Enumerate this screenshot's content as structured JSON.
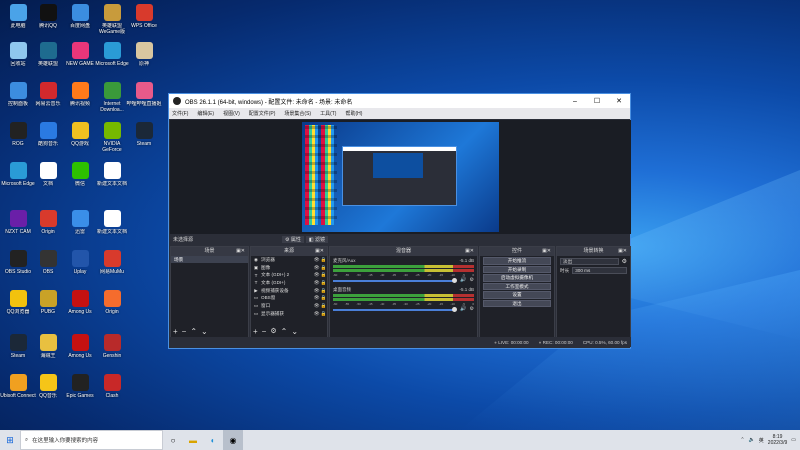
{
  "desktop_icons": [
    {
      "label": "此电脑",
      "color": "#4aa3e8",
      "icon": "computer-icon"
    },
    {
      "label": "腾讯QQ",
      "color": "#111111",
      "icon": "qq-icon"
    },
    {
      "label": "百度网盘",
      "color": "#3b8de0",
      "icon": "baidu-netdisk-icon"
    },
    {
      "label": "英雄联盟WeGame版",
      "color": "#c89b3c",
      "icon": "lol-icon"
    },
    {
      "label": "WPS Office",
      "color": "#d83a2c",
      "icon": "wps-icon"
    },
    {
      "label": "回收站",
      "color": "#8fc7ee",
      "icon": "recycle-bin-icon"
    },
    {
      "label": "英雄联盟",
      "color": "#1e6b8f",
      "icon": "league-icon"
    },
    {
      "label": "NEW GAME",
      "color": "#e8367a",
      "icon": "new-game-icon"
    },
    {
      "label": "Microsoft Edge",
      "color": "#2a9bd6",
      "icon": "edge-icon"
    },
    {
      "label": "原神",
      "color": "#d8c6a0",
      "icon": "genshin-icon"
    },
    {
      "label": "控制面板",
      "color": "#3c8de0",
      "icon": "control-panel-icon"
    },
    {
      "label": "网易云音乐",
      "color": "#d2292d",
      "icon": "netease-music-icon"
    },
    {
      "label": "腾讯视频",
      "color": "#ff7a1a",
      "icon": "tencent-video-icon"
    },
    {
      "label": "Internet Downloa...",
      "color": "#3a9a3a",
      "icon": "idm-icon"
    },
    {
      "label": "哔哩哔哩直播姬",
      "color": "#e85a8a",
      "icon": "bilibili-live-icon"
    },
    {
      "label": "ROG",
      "color": "#222222",
      "icon": "rog-icon"
    },
    {
      "label": "酷狗音乐",
      "color": "#2a7ae2",
      "icon": "kugou-icon"
    },
    {
      "label": "QQ游戏",
      "color": "#f0c020",
      "icon": "qq-game-icon"
    },
    {
      "label": "NVIDIA GeForce",
      "color": "#76b900",
      "icon": "nvidia-icon"
    },
    {
      "label": "Steam",
      "color": "#1b2838",
      "icon": "steam-icon"
    },
    {
      "label": "Microsoft Edge",
      "color": "#2a9bd6",
      "icon": "edge-icon"
    },
    {
      "label": "文档",
      "color": "#ffffff",
      "icon": "document-icon"
    },
    {
      "label": "微信",
      "color": "#2dc100",
      "icon": "wechat-icon"
    },
    {
      "label": "新建文本文档",
      "color": "#ffffff",
      "icon": "text-file-icon"
    },
    {
      "label": "NZXT CAM",
      "color": "#6a1fa8",
      "icon": "nzxt-icon"
    },
    {
      "label": "Origin",
      "color": "#d83a2c",
      "icon": "origin-icon"
    },
    {
      "label": "迅雷",
      "color": "#3a8ee8",
      "icon": "xunlei-icon"
    },
    {
      "label": "新建文本文档",
      "color": "#ffffff",
      "icon": "text-file-icon"
    },
    {
      "label": "OBS Studio",
      "color": "#222222",
      "icon": "obs-icon"
    },
    {
      "label": "OBS",
      "color": "#333333",
      "icon": "obs-icon"
    },
    {
      "label": "Uplay",
      "color": "#2255aa",
      "icon": "uplay-icon"
    },
    {
      "label": "网易MuMu",
      "color": "#d83a2c",
      "icon": "mumu-icon"
    },
    {
      "label": "QQ浏览器",
      "color": "#f2c20e",
      "icon": "qq-browser-icon"
    },
    {
      "label": "PUBG",
      "color": "#c9a227",
      "icon": "pubg-icon"
    },
    {
      "label": "Among Us",
      "color": "#c51111",
      "icon": "among-us-icon"
    },
    {
      "label": "Origin",
      "color": "#f56c2d",
      "icon": "origin-icon"
    },
    {
      "label": "Steam",
      "color": "#1b2838",
      "icon": "steam-icon"
    },
    {
      "label": "海贼王",
      "color": "#e8c040",
      "icon": "onepiece-icon"
    },
    {
      "label": "Among Us",
      "color": "#c51111",
      "icon": "among-us-icon"
    },
    {
      "label": "Genshin",
      "color": "#b82a2a",
      "icon": "genshin-icon"
    },
    {
      "label": "Ubisoft Connect",
      "color": "#f0a020",
      "icon": "ubisoft-icon"
    },
    {
      "label": "QQ音乐",
      "color": "#f5c518",
      "icon": "qq-music-icon"
    },
    {
      "label": "Epic Games",
      "color": "#222222",
      "icon": "epic-icon"
    },
    {
      "label": "Clash",
      "color": "#c82828",
      "icon": "clash-icon"
    }
  ],
  "obs": {
    "title": "OBS 26.1.1 (64-bit, windows) - 配置文件: 未命名 - 场景: 未命名",
    "menu": [
      "文件(F)",
      "编辑(E)",
      "视图(V)",
      "配置文件(P)",
      "场景集合(S)",
      "工具(T)",
      "帮助(H)"
    ],
    "no_source": "未选择源",
    "props_label": "属性",
    "filter_label": "滤镜",
    "docks": {
      "scenes": "场景",
      "sources": "来源",
      "mixer": "混音器",
      "controls": "控件",
      "transitions": "场景转换"
    },
    "scene_items": [
      "场景"
    ],
    "sources": [
      {
        "icon": "browser-icon",
        "glyph": "◉",
        "name": "浏览器"
      },
      {
        "icon": "image-icon",
        "glyph": "▣",
        "name": "图像"
      },
      {
        "icon": "text-icon",
        "glyph": "T",
        "name": "文本 (GDI+) 2"
      },
      {
        "icon": "text-icon",
        "glyph": "T",
        "name": "文本 (GDI+)"
      },
      {
        "icon": "video-capture-icon",
        "glyph": "▶",
        "name": "视频捕获设备"
      },
      {
        "icon": "capture-icon",
        "glyph": "▭",
        "name": "OBS窗"
      },
      {
        "icon": "capture-icon",
        "glyph": "▭",
        "name": "窗口"
      },
      {
        "icon": "monitor-icon",
        "glyph": "▭",
        "name": "显示器捕获"
      }
    ],
    "mixer": [
      {
        "name": "麦克风/Aux",
        "db": "-5.1 dB"
      },
      {
        "name": "桌面音频",
        "db": "-5.1 dB"
      }
    ],
    "mixer_ticks": [
      "-60",
      "-55",
      "-50",
      "-45",
      "-40",
      "-35",
      "-30",
      "-25",
      "-20",
      "-15",
      "-10",
      "-5",
      "0"
    ],
    "controls": [
      "开始推流",
      "开始录制",
      "启动虚拟摄像机",
      "工作室模式",
      "设置",
      "退出"
    ],
    "transition_value": "淡出",
    "duration_label": "时长",
    "duration_value": "300 ms",
    "status": {
      "live": "LIVE: 00:00:00",
      "rec": "REC: 00:00:00",
      "cpu": "CPU: 0.5%, 60.00 fps"
    }
  },
  "taskbar": {
    "search_placeholder": "在这里输入你要搜索的内容",
    "time": "8:19",
    "date": "2022/3/9",
    "input_method": "英"
  }
}
